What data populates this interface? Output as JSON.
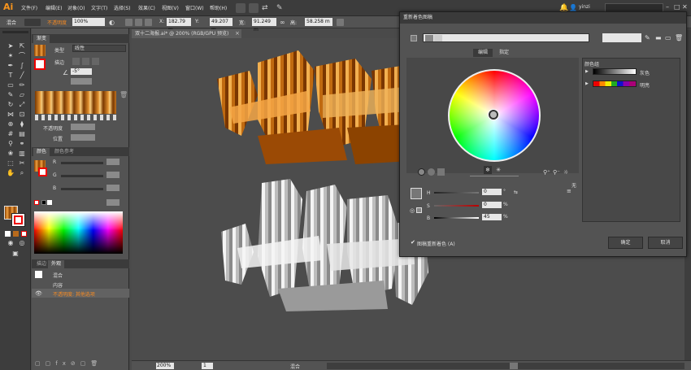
{
  "app": {
    "logo": "Ai",
    "user": "yinzi"
  },
  "menu": [
    "文件(F)",
    "编辑(E)",
    "对象(O)",
    "文字(T)",
    "选择(S)",
    "效果(C)",
    "视图(V)",
    "窗口(W)",
    "帮助(H)"
  ],
  "control_bar": {
    "mode_label": "混合",
    "opacity_label": "不透明度",
    "zoom_value": "100%",
    "x_label": "X:",
    "x_value": "182.79 m",
    "y_label": "Y:",
    "y_value": "49.207 m",
    "w_label": "宽:",
    "w_value": "91.249 m",
    "h_label": "高:",
    "h_value": "58.258 m"
  },
  "document": {
    "tab_title": "双十二海报.ai* @ 200% (RGB/GPU 预览)"
  },
  "gradient_panel": {
    "tab": "渐变",
    "type_label": "类型",
    "type_value": "线性",
    "stroke_label": "描边",
    "angle_value": "-5°",
    "opacity_label": "不透明度",
    "position_label": "位置"
  },
  "color_panel": {
    "tabs": [
      "颜色",
      "颜色参考"
    ],
    "channels": [
      "R",
      "G",
      "B"
    ]
  },
  "appearance_panel": {
    "tabs": [
      "描边",
      "外观"
    ],
    "rows": [
      "混合",
      "内容",
      "不透明度: 其他选项"
    ]
  },
  "dialog": {
    "title": "重新着色图稿",
    "tabs": [
      "编辑",
      "指定"
    ],
    "preset_value": "",
    "group_label": "颜色组",
    "groups": [
      "灰色",
      "明亮"
    ],
    "hsb": [
      {
        "label": "H",
        "value": "0",
        "unit": "°"
      },
      {
        "label": "S",
        "value": "0",
        "unit": "%"
      },
      {
        "label": "B",
        "value": "45",
        "unit": "%"
      }
    ],
    "recolor_checkbox_label": "图稿重新着色 (A)",
    "ok_label": "确定",
    "cancel_label": "取消",
    "none_label": "无"
  },
  "status": {
    "zoom": "200%",
    "page": "1",
    "mode": "混合"
  },
  "colors": {
    "accent": "#f58a23",
    "ui_dark": "#3c3c3c",
    "panel": "#535353",
    "canvas": "#4c4c4c"
  }
}
